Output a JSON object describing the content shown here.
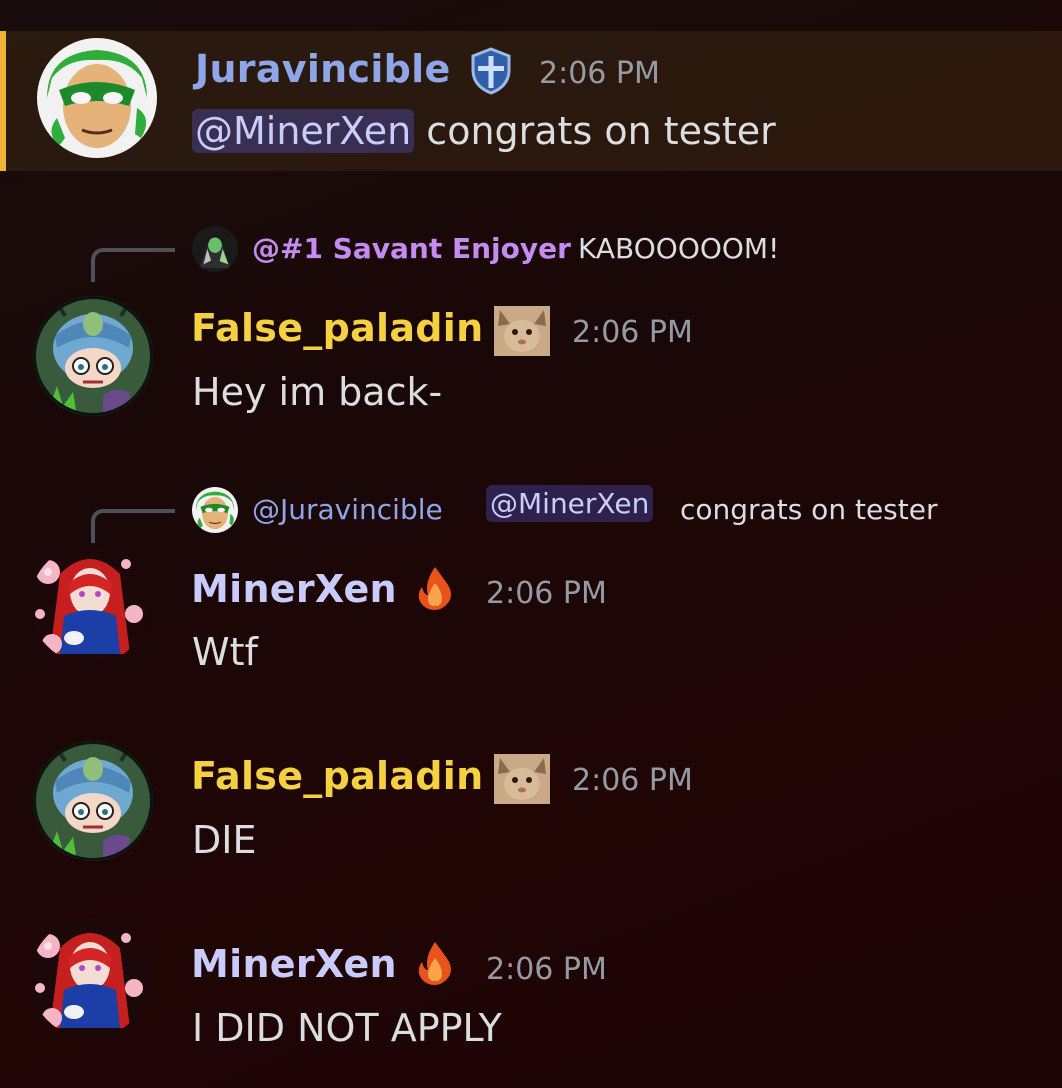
{
  "messages": [
    {
      "username": "Juravincible",
      "username_color": "#8ea6e8",
      "badge": "shield-icon",
      "timestamp": "2:06 PM",
      "mention": "@MinerXen",
      "text": " congrats on tester",
      "highlighted": true
    },
    {
      "reply": {
        "name": "@#1 Savant Enjoyer",
        "name_color": "#c58bf0",
        "text": "KABOOOOOM!"
      },
      "username": "False_paladin",
      "username_color": "#f5d142",
      "badge": "cat-emoji",
      "timestamp": "2:06 PM",
      "text": "Hey im back-"
    },
    {
      "reply": {
        "name": "@Juravincible",
        "name_color": "#8ea6e8",
        "mention": "@MinerXen",
        "text": "congrats on tester"
      },
      "username": "MinerXen",
      "username_color": "#c9ccfa",
      "badge": "fire-icon",
      "timestamp": "2:06 PM",
      "text": "Wtf"
    },
    {
      "username": "False_paladin",
      "username_color": "#f5d142",
      "badge": "cat-emoji",
      "timestamp": "2:06 PM",
      "text": "DIE"
    },
    {
      "username": "MinerXen",
      "username_color": "#c9ccfa",
      "badge": "fire-icon",
      "timestamp": "2:06 PM",
      "text": "I DID NOT APPLY"
    }
  ],
  "colors": {
    "highlight_bar": "#f0b232",
    "mention_bg": "#3b3f7a",
    "timestamp": "#949ba4",
    "text": "#dbdee1"
  }
}
